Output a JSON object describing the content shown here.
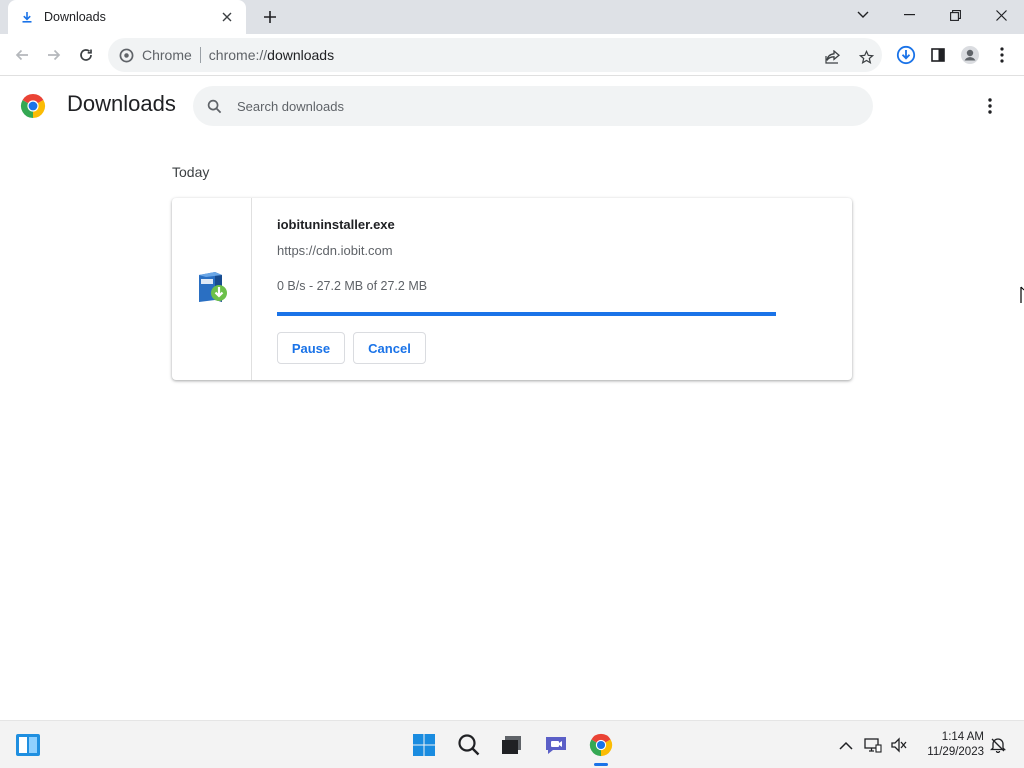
{
  "window": {
    "tab_title": "Downloads",
    "tab_icon": "download-icon"
  },
  "toolbar": {
    "site_chip": "Chrome",
    "url_scheme": "chrome://",
    "url_path": "downloads"
  },
  "page": {
    "title": "Downloads",
    "search_placeholder": "Search downloads"
  },
  "downloads": {
    "date_heading": "Today",
    "items": [
      {
        "file_name": "iobituninstaller.exe",
        "url": "https://cdn.iobit.com",
        "status": "0 B/s - 27.2 MB of 27.2 MB",
        "progress": 1.0,
        "file_icon": "iobit-installer-icon",
        "pause_label": "Pause",
        "cancel_label": "Cancel"
      }
    ]
  },
  "taskbar": {
    "time": "1:14 AM",
    "date": "11/29/2023"
  },
  "colors": {
    "accent": "#1a73e8",
    "tabstrip": "#dee1e6",
    "omnibox": "#f1f3f4"
  }
}
